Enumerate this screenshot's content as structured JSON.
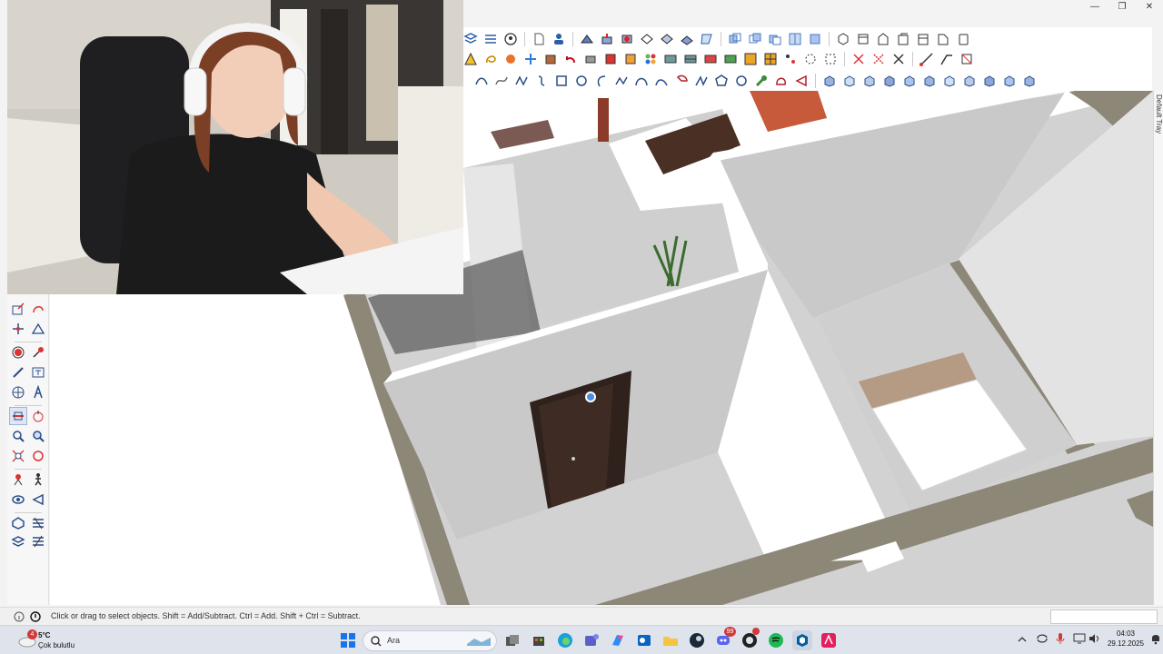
{
  "window": {
    "minimize_icon": "minimize-icon",
    "maximize_icon": "maximize-icon",
    "close_icon": "close-icon"
  },
  "tray": {
    "default_tray_label": "Default Tray"
  },
  "status": {
    "hint_text": "Click or drag to select objects. Shift = Add/Subtract. Ctrl = Add. Shift + Ctrl = Subtract."
  },
  "weather": {
    "badge": "4",
    "temperature": "5°C",
    "description": "Çok bulutlu"
  },
  "taskbar": {
    "search_placeholder": "Ara",
    "discord_badge": "99"
  },
  "clock": {
    "time": "04:03",
    "date": "29.12.2025"
  },
  "colors": {
    "accent": "#1a73e8",
    "wall_top": "#ffffff",
    "wall_side": "#c9c9c9",
    "floor": "#d3d3d3",
    "outer_wall": "#8d8778",
    "door": "#3a2a24",
    "bed_headboard": "#b59a84",
    "sofa": "#c65a3a"
  }
}
